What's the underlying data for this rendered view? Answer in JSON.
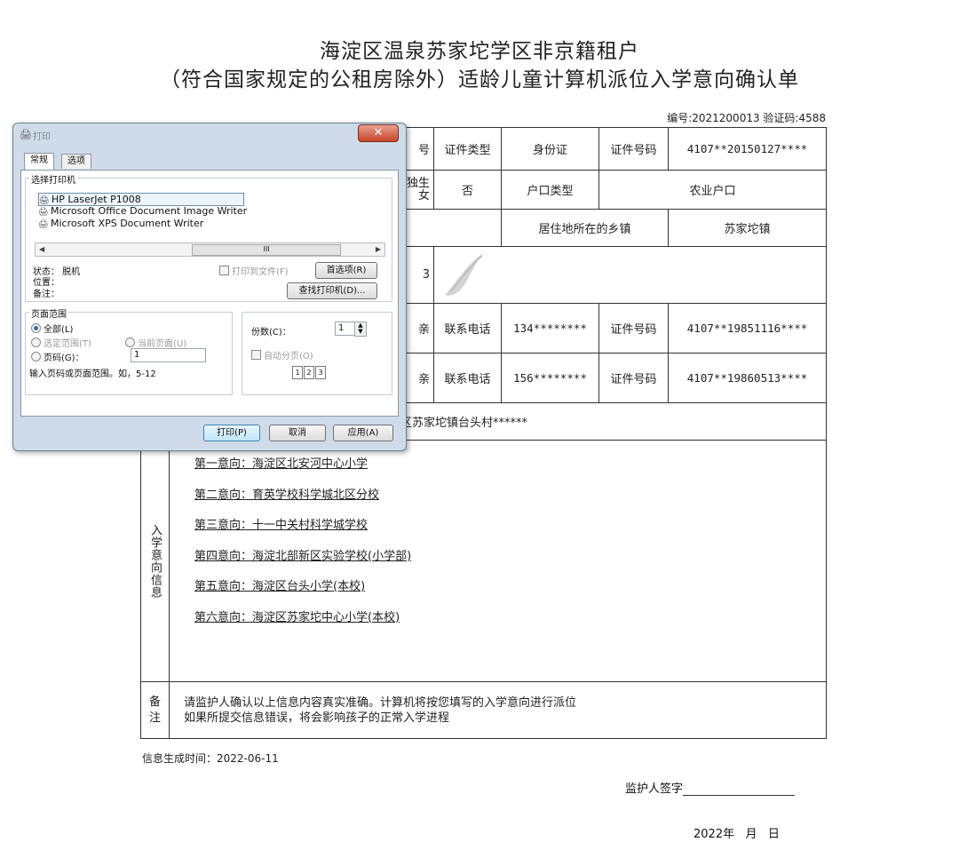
{
  "document": {
    "title_line1": "海淀区温泉苏家坨学区非京籍租户",
    "title_line2": "（符合国家规定的公租房除外）适龄儿童计算机派位入学意向确认单",
    "serial": "编号:2021200013  验证码:4588",
    "row1": {
      "partial": "号",
      "id_type_label": "证件类型",
      "id_type_value": "身份证",
      "id_no_label": "证件号码",
      "id_no_value": "4107**20150127****"
    },
    "row2": {
      "partial": "独生\n女",
      "only_child_value": "否",
      "hukou_label": "户口类型",
      "hukou_value": "农业户口"
    },
    "row3": {
      "town_label": "居住地所在的乡镇",
      "town_value": "苏家坨镇"
    },
    "row4": {
      "partial": "3"
    },
    "row5": {
      "partial": "亲",
      "phone_label": "联系电话",
      "phone_value": "134********",
      "id_no_label": "证件号码",
      "id_no_value": "4107**19851116****"
    },
    "row6": {
      "partial": "亲",
      "phone_label": "联系电话",
      "phone_value": "156********",
      "id_no_label": "证件号码",
      "id_no_value": "4107**19860513****"
    },
    "row7": {
      "address": "区苏家坨镇台头村******"
    },
    "intent_label": "入学意向信息",
    "choices": [
      "第一意向：海淀区北安河中心小学",
      "第二意向：育英学校科学城北区分校",
      "第三意向：十一中关村科学城学校",
      "第四意向：海淀北部新区实验学校(小学部)",
      "第五意向：海淀区台头小学(本校)",
      "第六意向：海淀区苏家坨中心小学(本校)"
    ],
    "remark_label": "备注",
    "remark_line1": "请监护人确认以上信息内容真实准确。计算机将按您填写的入学意向进行派位",
    "remark_line2": "如果所提交信息错误，将会影响孩子的正常入学进程",
    "generated": "信息生成时间：2022-06-11",
    "signature_label": "监护人签字",
    "date": "2022年   月   日"
  },
  "print_dialog": {
    "title": "打印",
    "tabs": [
      "常规",
      "选项"
    ],
    "select_printer_label": "选择打印机",
    "printers": [
      "HP LaserJet P1008",
      "Microsoft Office Document Image Writer",
      "Microsoft XPS Document Writer"
    ],
    "scroll_mid": "III",
    "status_label": "状态：  脱机",
    "location_label": "位置：",
    "comment_label": "备注：",
    "print_to_file": "打印到文件(F)",
    "preferences": "首选项(R)",
    "find_printer": "查找打印机(D)...",
    "page_range_label": "页面范围",
    "all": "全部(L)",
    "selection": "选定范围(T)",
    "current_page": "当前页面(U)",
    "pages": "页码(G)：",
    "pages_value": "1",
    "hint": "输入页码或页面范围。如，5-12",
    "copies_label": "份数(C)：",
    "copies_value": "1",
    "collate": "自动分页(O)",
    "print_btn": "打印(P)",
    "cancel_btn": "取消",
    "apply_btn": "应用(A)"
  }
}
